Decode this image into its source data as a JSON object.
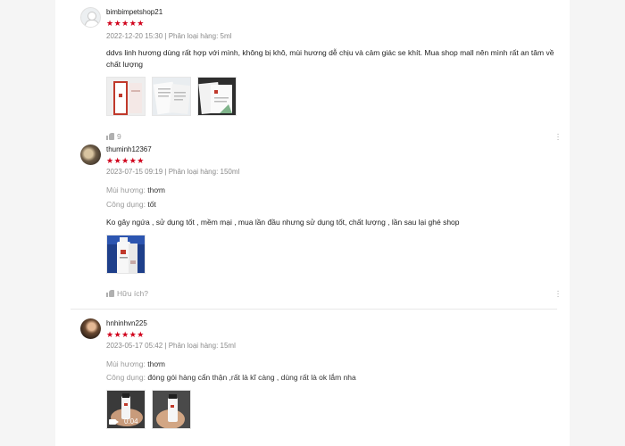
{
  "reviews": [
    {
      "username": "bimbimpetshop21",
      "stars": "★★★★★",
      "meta": "2022-12-20 15:30 | Phân loại hàng: 5ml",
      "body": "ddvs linh hương dùng rất hợp với mình, không bị khô, mùi hương dễ chịu và cảm giác se khít. Mua shop mall nên mình rất an tâm về chất lượng",
      "likes": "9"
    },
    {
      "username": "thuminh12367",
      "stars": "★★★★★",
      "meta": "2023-07-15 09:19 | Phân loại hàng: 150ml",
      "attr1_label": "Mùi hương:",
      "attr1_value": "thơm",
      "attr2_label": "Công dụng:",
      "attr2_value": "tốt",
      "body": "Ko gây ngứa , sử dụng tốt , mềm mại , mua lần đầu nhưng sử dụng tốt, chất lượng , lần sau lại ghé shop",
      "helpful": "Hữu ích?"
    },
    {
      "username": "hnhinhvn225",
      "stars": "★★★★★",
      "meta": "2023-05-17 05:42 | Phân loại hàng: 15ml",
      "attr1_label": "Mùi hương:",
      "attr1_value": "thơm",
      "attr2_label": "Công dụng:",
      "attr2_value": "đóng gói hàng cẩn thận ,rất là kĩ càng , dùng rất là ok lắm nha",
      "video_duration": "0:04"
    }
  ],
  "icons": {
    "more": "more-vertical-icon",
    "like": "thumbs-up-icon",
    "video": "video-camera-icon"
  },
  "colors": {
    "star": "#d0011b",
    "muted": "#9a9a9a"
  }
}
